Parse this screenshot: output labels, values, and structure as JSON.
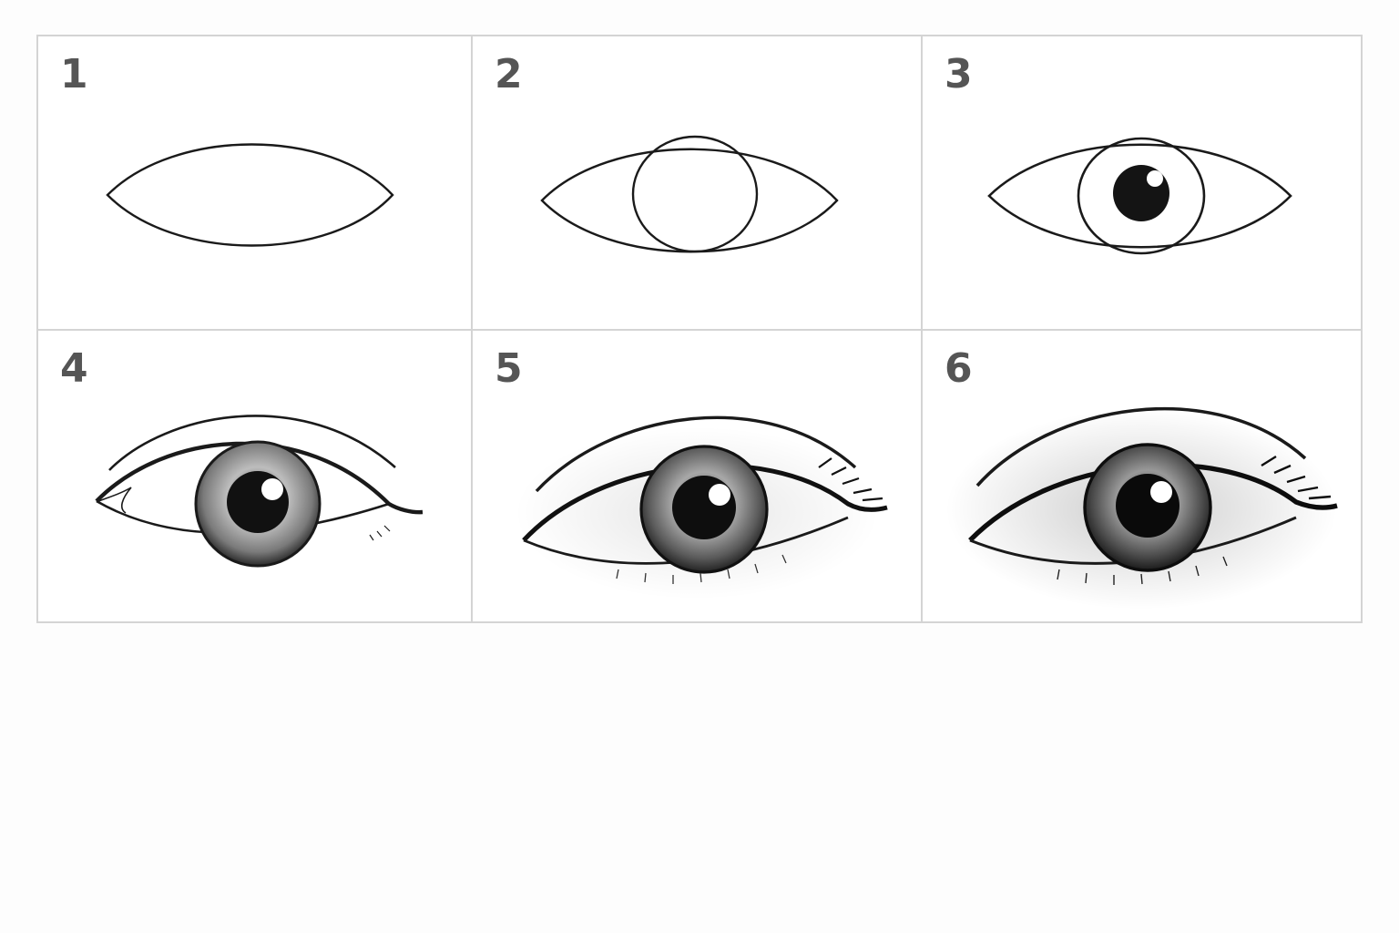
{
  "colors": {
    "border": "#d4d4d4",
    "ink": "#1a1a1a",
    "label": "#555555",
    "background": "#fdfdfd"
  },
  "steps": [
    {
      "number": "1"
    },
    {
      "number": "2"
    },
    {
      "number": "3"
    },
    {
      "number": "4"
    },
    {
      "number": "5"
    },
    {
      "number": "6"
    }
  ]
}
